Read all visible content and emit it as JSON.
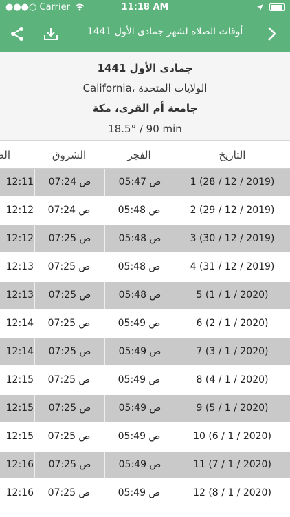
{
  "status": {
    "carrier": "Carrier",
    "time": "11:18 AM"
  },
  "nav": {
    "title": "أوقات الصلاة لشهر جمادى الأول 1441"
  },
  "header": {
    "month": "جمادى الأول 1441",
    "location": "California، الولايات المتحدة",
    "organization": "جامعة أم القرى، مكة",
    "method": "18.5° / 90 min"
  },
  "columns": {
    "date": "التاريخ",
    "fajr": "الفجر",
    "sunrise": "الشروق",
    "dhuhr": "الظ"
  },
  "rows": [
    {
      "date": "1 (28 / 12 / 2019)",
      "fajr": "05:47 ص",
      "sunrise": "07:24 ص",
      "dhuhr": "12:11"
    },
    {
      "date": "2 (29 / 12 / 2019)",
      "fajr": "05:48 ص",
      "sunrise": "07:24 ص",
      "dhuhr": "12:12"
    },
    {
      "date": "3 (30 / 12 / 2019)",
      "fajr": "05:48 ص",
      "sunrise": "07:25 ص",
      "dhuhr": "12:12"
    },
    {
      "date": "4 (31 / 12 / 2019)",
      "fajr": "05:48 ص",
      "sunrise": "07:25 ص",
      "dhuhr": "12:13"
    },
    {
      "date": "5 (1 / 1 / 2020)",
      "fajr": "05:48 ص",
      "sunrise": "07:25 ص",
      "dhuhr": "12:13"
    },
    {
      "date": "6 (2 / 1 / 2020)",
      "fajr": "05:49 ص",
      "sunrise": "07:25 ص",
      "dhuhr": "12:14"
    },
    {
      "date": "7 (3 / 1 / 2020)",
      "fajr": "05:49 ص",
      "sunrise": "07:25 ص",
      "dhuhr": "12:14"
    },
    {
      "date": "8 (4 / 1 / 2020)",
      "fajr": "05:49 ص",
      "sunrise": "07:25 ص",
      "dhuhr": "12:15"
    },
    {
      "date": "9 (5 / 1 / 2020)",
      "fajr": "05:49 ص",
      "sunrise": "07:25 ص",
      "dhuhr": "12:15"
    },
    {
      "date": "10 (6 / 1 / 2020)",
      "fajr": "05:49 ص",
      "sunrise": "07:25 ص",
      "dhuhr": "12:15"
    },
    {
      "date": "11 (7 / 1 / 2020)",
      "fajr": "05:49 ص",
      "sunrise": "07:25 ص",
      "dhuhr": "12:16"
    },
    {
      "date": "12 (8 / 1 / 2020)",
      "fajr": "05:49 ص",
      "sunrise": "07:25 ص",
      "dhuhr": "12:16"
    }
  ],
  "icons": {
    "share": "share-icon",
    "download": "download-icon",
    "forward": "chevron-right-icon",
    "wifi": "wifi-icon",
    "location": "location-arrow-icon",
    "battery": "battery-icon"
  },
  "colors": {
    "primary": "#5cb37c",
    "row_shade": "#c9c9c9",
    "header_bg": "#f5f5f5"
  }
}
